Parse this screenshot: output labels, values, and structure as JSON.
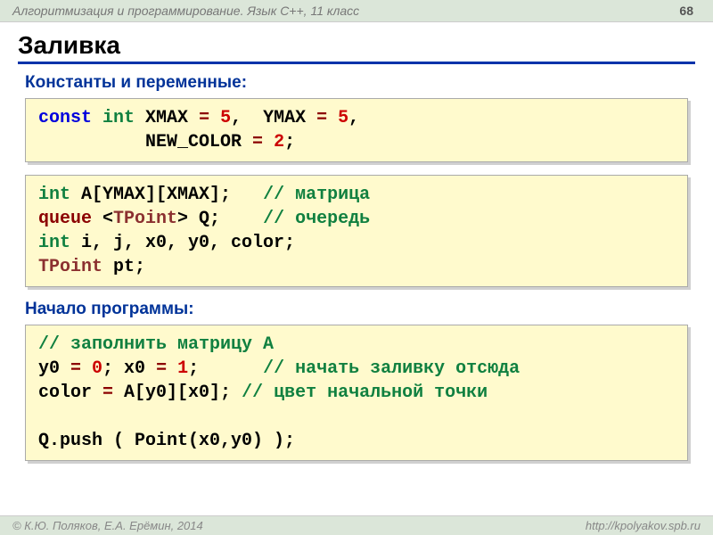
{
  "header": {
    "title": "Алгоритмизация и программирование. Язык C++, 11 класс",
    "page_number": "68"
  },
  "title": "Заливка",
  "sections": {
    "constants": {
      "label": "Константы и переменные:"
    },
    "start": {
      "label": "Начало программы:"
    }
  },
  "code": {
    "block1": {
      "l1_const": "const",
      "l1_int": "int",
      "l1_xmax": " XMAX",
      "l1_eq1": " = ",
      "l1_v1": "5",
      "l1_comma1": ",  YMAX",
      "l1_eq2": " = ",
      "l1_v2": "5",
      "l1_comma2": ",",
      "l2_pad": "          NEW_COLOR",
      "l2_eq": " = ",
      "l2_v": "2",
      "l2_semi": ";"
    },
    "block2": {
      "l1_int": "int",
      "l1_rest": " A[YMAX][XMAX];   ",
      "l1_comment": "// матрица",
      "l2_queue": "queue",
      "l2_a": " <",
      "l2_tpoint": "TPoint",
      "l2_b": "> Q;    ",
      "l2_comment": "// очередь",
      "l3_int": "int",
      "l3_rest": " i, j, x0, y0, color;",
      "l4_tpoint": "TPoint",
      "l4_rest": " pt;"
    },
    "block3": {
      "l1_comment": "// заполнить матрицу A",
      "l2_a": "y0",
      "l2_eq1": " = ",
      "l2_v1": "0",
      "l2_b": "; x0",
      "l2_eq2": " = ",
      "l2_v2": "1",
      "l2_c": ";      ",
      "l2_comment": "// начать заливку отсюда",
      "l3_a": "color",
      "l3_eq": " = ",
      "l3_b": "A[y0][x0]; ",
      "l3_comment": "// цвет начальной точки",
      "blank": " ",
      "l4": "Q.push ( Point(x0,y0) );"
    }
  },
  "footer": {
    "left": "© К.Ю. Поляков, Е.А. Ерёмин, 2014",
    "right": "http://kpolyakov.spb.ru"
  }
}
